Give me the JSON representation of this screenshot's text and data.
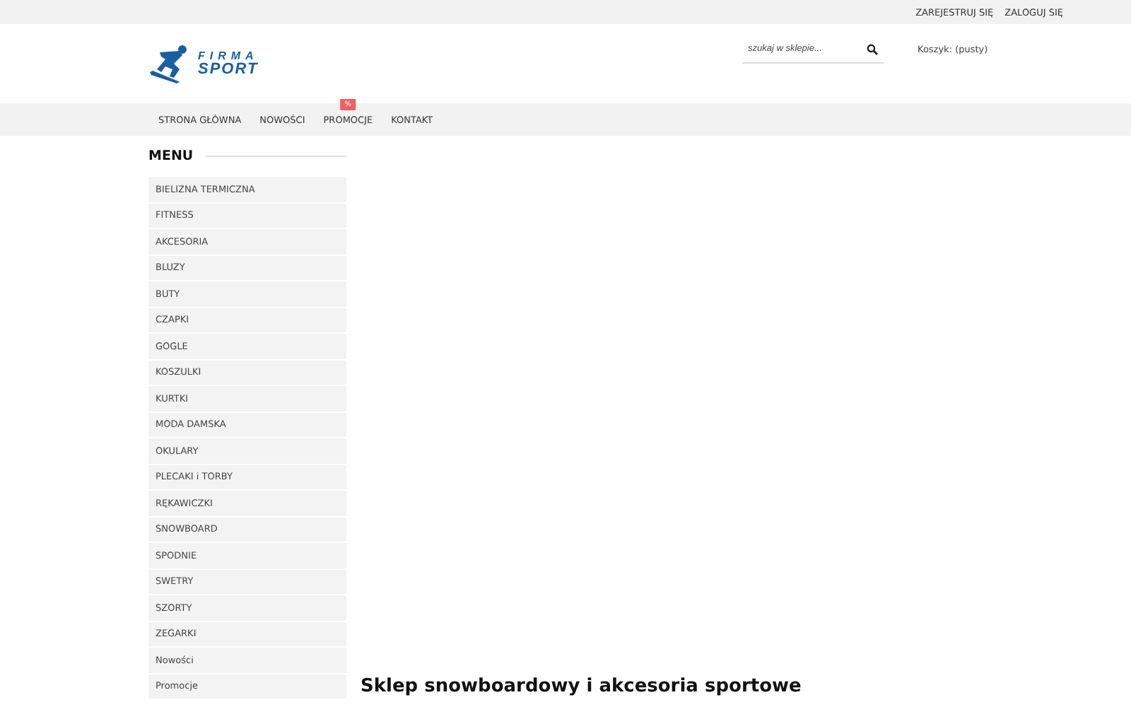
{
  "top_links": [
    "ZAREJESTRUJ SIĘ",
    "ZALOGUJ SIĘ"
  ],
  "logo": {
    "line_1": "FIRMA",
    "line_2": "SPORT"
  },
  "search": {
    "placeholder": "szukaj w sklepie..."
  },
  "cart": "Koszyk: (pusty)",
  "nav": [
    {
      "label": "STRONA GŁÓWNA"
    },
    {
      "label": "NOWOŚCI"
    },
    {
      "label": "PROMOCJE",
      "badge": "%"
    },
    {
      "label": "KONTAKT"
    }
  ],
  "menu": {
    "title": "MENU",
    "items": [
      "BIELIZNA TERMICZNA",
      "FITNESS",
      "AKCESORIA",
      "BLUZY",
      "BUTY",
      "CZAPKI",
      "GOGLE",
      "KOSZULKI",
      "KURTKI",
      "MODA DAMSKA",
      "OKULARY",
      "PLECAKI i TORBY",
      "RĘKAWICZKI",
      "SNOWBOARD",
      "SPODNIE",
      "SWETRY",
      "SZORTY",
      "ZEGARKI",
      "Nowości",
      "Promocje"
    ]
  },
  "heading": "Sklep snowboardowy i akcesoria sportowe"
}
